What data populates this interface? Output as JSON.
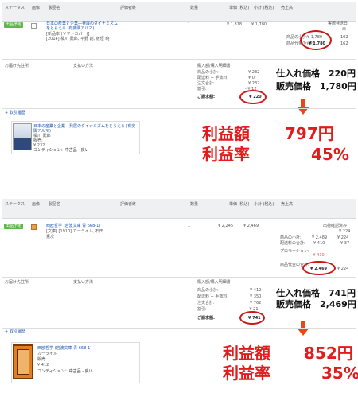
{
  "headers": {
    "status": "ステータス",
    "pic": "画像",
    "product": "製品名",
    "review": "評価者終",
    "qty": "数量",
    "price_tax": "単価\n(税込)",
    "subtotal_tax": "小計\n(税込)",
    "sales": "売上高"
  },
  "panel1": {
    "badge": "出品予定",
    "product_title": "日本の産業と企業―発展のダイナミズムをとらえる (有斐閣アルマ)",
    "product_meta": "[新品本 (ソフトカバー)]",
    "product_meta2": "[2014] 橘川 武郎, 平野 創, 板垣 暁",
    "qty": "1",
    "price": "¥ 1,818",
    "subtotal": "¥ 1,780",
    "right_label": "実際発送日",
    "right_sub": "未",
    "sales_rows": [
      {
        "label": "商品の小計:",
        "value": "¥ 1,780",
        "extra": "102"
      },
      {
        "label": "商品代金の合計:",
        "value": "¥ 1,780",
        "extra": "162"
      }
    ],
    "ship_to_label": "お届け先住所",
    "pay_label": "支払い方法",
    "summary_title": "購入額/購入明細書",
    "summary_rows": [
      {
        "label": "商品の小計:",
        "value": "¥ 232"
      },
      {
        "label": "配送料 + 手数料:",
        "value": "¥ 0"
      },
      {
        "label": "注文合計:",
        "value": "¥ 232"
      },
      {
        "label": "割引:",
        "value": "- ¥ 12"
      }
    ],
    "billing_label": "ご請求額:",
    "billing_value": "¥ 220",
    "history_link": "+ 取引履歴",
    "cost_label": "仕入れ価格",
    "cost_value": "220円",
    "sale_label": "販売価格",
    "sale_value": "1,780円",
    "card_title": "日本の産業と企業―発展のダイナミズムをとらえる (有斐閣アルマ)",
    "card_author": "橘川 武郎",
    "card_lines": [
      "販売:",
      "¥ 232"
    ],
    "card_condition": "コンディション：中古品 - 良い",
    "profit_label": "利益額",
    "profit_value": "797円",
    "rate_label": "利益率",
    "rate_value": "45%"
  },
  "panel2": {
    "badge": "出品予定",
    "product_title": "西欧哲学 (岩波文庫 青 668-1)",
    "product_meta": "[文庫] [1910] カーライル, 石田",
    "product_meta2": "憲次",
    "qty": "1",
    "price": "¥ 2,245",
    "subtotal": "¥ 2,469",
    "right_label": "出荷確認済み",
    "right_sub": "¥ 224",
    "sales_rows": [
      {
        "label": "商品の小計:",
        "value": "¥ 2,489",
        "extra": "¥ 224"
      },
      {
        "label": "配送料の合計:",
        "value": "¥ 410",
        "extra": "¥ 37"
      },
      {
        "label": "プロモーション:",
        "value": "- ¥ 410",
        "extra": ""
      },
      {
        "label": "商品代金の合計:",
        "value": "¥ 2,469",
        "extra": "¥ 224"
      }
    ],
    "ship_to_label": "お届け先住所",
    "pay_label": "支払い方法",
    "summary_title": "購入額/購入明細書",
    "summary_rows": [
      {
        "label": "商品の小計:",
        "value": "¥ 412"
      },
      {
        "label": "配送料 + 手数料:",
        "value": "¥ 350"
      },
      {
        "label": "注文合計:",
        "value": "¥ 762"
      },
      {
        "label": "割引:",
        "value": "- ¥ 21"
      }
    ],
    "billing_label": "ご請求額:",
    "billing_value": "¥ 741",
    "history_link": "+ 取引履歴",
    "cost_label": "仕入れ価格",
    "cost_value": "741円",
    "sale_label": "販売価格",
    "sale_value": "2,469円",
    "card_title": "西欧哲学 (岩波文庫 青 668-1)",
    "card_author": "カーライル",
    "card_lines": [
      "販売:",
      "¥ 412"
    ],
    "card_condition": "コンディション：中古品 - 良い",
    "profit_label": "利益額",
    "profit_value": "852円",
    "rate_label": "利益率",
    "rate_value": "35%"
  },
  "colors": {
    "accent_red": "#e21c1c",
    "arrow": "#e8461b",
    "badge_green": "#5fb84a",
    "link_blue": "#1a56b0"
  }
}
